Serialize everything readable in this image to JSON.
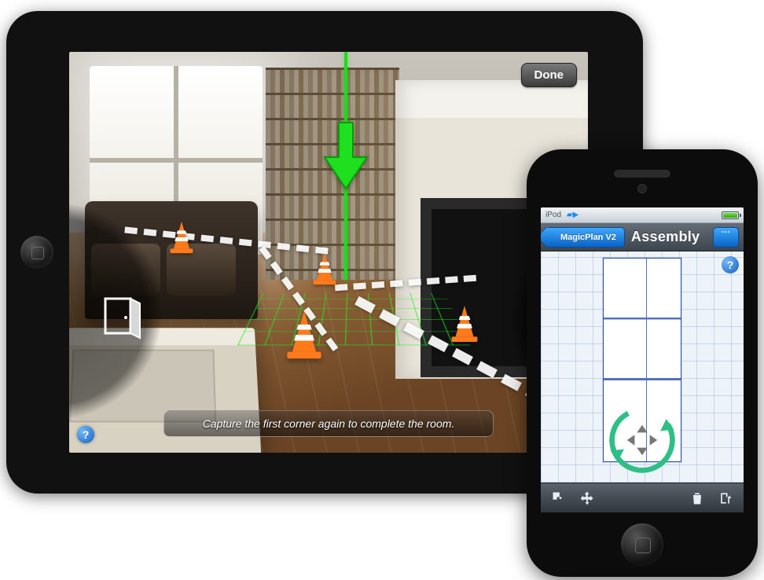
{
  "ipad": {
    "done_label": "Done",
    "hint_text": "Capture the first corner again to complete the room.",
    "help_label": "?",
    "icons": {
      "door": "door-icon",
      "arrow": "down-arrow-icon",
      "cone": "traffic-cone-icon"
    }
  },
  "iphone": {
    "status": {
      "device": "iPod",
      "wifi_glyph": "▶"
    },
    "nav": {
      "back_label": "MagicPlan V2",
      "title": "Assembly",
      "right_label": "···"
    },
    "help_label": "?",
    "toolbar": {
      "room_add": "room-icon",
      "move": "move-icon",
      "trash": "trash-icon",
      "export": "export-icon"
    }
  }
}
